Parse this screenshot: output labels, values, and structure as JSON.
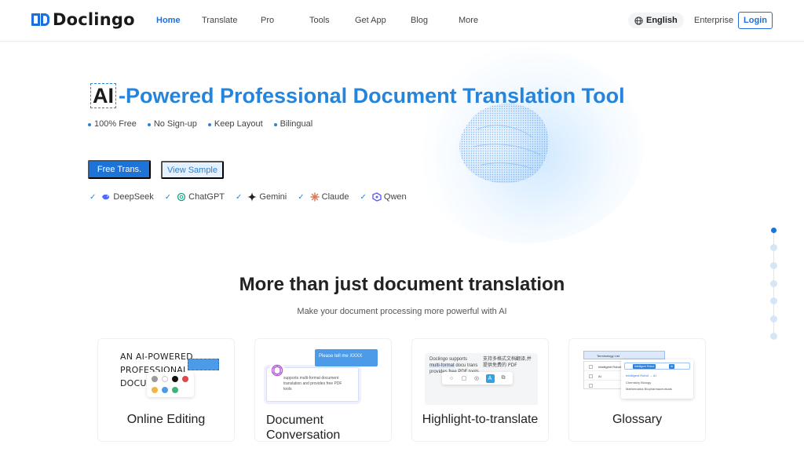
{
  "header": {
    "logo_text": "Doclingo",
    "nav": [
      {
        "label": "Home",
        "active": true
      },
      {
        "label": "Translate"
      },
      {
        "label": "Pro"
      },
      {
        "label": "Tools"
      },
      {
        "label": "Get App"
      },
      {
        "label": "Blog"
      },
      {
        "label": "More"
      }
    ],
    "language": "English",
    "enterprise": "Enterprise",
    "login": "Login"
  },
  "hero": {
    "title_ai": "AI",
    "title_rest": "-Powered Professional Document Translation Tool",
    "features": [
      "100% Free",
      "No Sign-up",
      "Keep Layout",
      "Bilingual"
    ],
    "primary_button": "Free Trans.",
    "secondary_button": "View Sample",
    "models": [
      "DeepSeek",
      "ChatGPT",
      "Gemini",
      "Claude",
      "Qwen"
    ]
  },
  "section": {
    "title": "More than just document translation",
    "subtitle": "Make your document processing more powerful with AI",
    "cards": [
      {
        "label": "Online Editing",
        "illustration_lines": [
          "AN AI-POWERED",
          "PROFESSIONAL",
          "DOCUM"
        ]
      },
      {
        "label": "Document Conversation",
        "label_line1": "Document",
        "label_line2": "Conversation",
        "bubble": "Please tell me XXXX",
        "doc_text": "supports multi-format document translation and provides free PDF tools"
      },
      {
        "label": "Highlight-to-translate",
        "left_text_a": "Doclingo supports",
        "left_text_hl": "multi-format",
        "left_text_b": "docu trans provides free PDF tools",
        "right_text": "支持多格式文档翻译,并提供免费的 PDF"
      },
      {
        "label": "Glossary",
        "tab": "Terminology List",
        "rows": [
          "Intelligent Robot",
          "AI"
        ],
        "chips": [
          "Intelligent Robot",
          "AI"
        ],
        "pop_lines": [
          "Intelligent Robot → AI",
          "Chemistry      Biology",
          "Mathematics    Biopharmaceuticals"
        ]
      }
    ]
  },
  "colors": {
    "accent": "#1e73d8",
    "title_blue": "#2584dc"
  }
}
